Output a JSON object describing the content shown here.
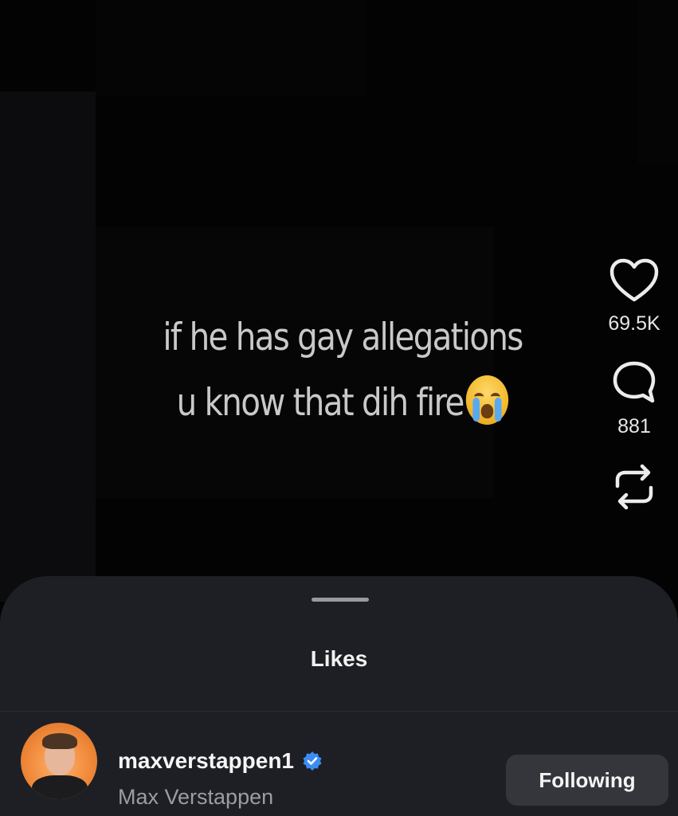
{
  "post": {
    "caption_line1": "if he has gay allegations",
    "caption_line2": "u know that dih fire",
    "caption_emoji": "loudly-crying-face"
  },
  "actions": {
    "like_icon": "heart-icon",
    "like_count": "69.5K",
    "comment_icon": "comment-icon",
    "comment_count": "881",
    "repost_icon": "repost-icon"
  },
  "sheet": {
    "title": "Likes",
    "users": [
      {
        "username": "maxverstappen1",
        "display_name": "Max Verstappen",
        "verified": true,
        "follow_state": "Following"
      }
    ]
  },
  "colors": {
    "background": "#030304",
    "sheet_background": "#1e1f24",
    "verified_badge": "#3b8cf5",
    "follow_button": "#34363c",
    "secondary_text": "#9c9da3"
  }
}
